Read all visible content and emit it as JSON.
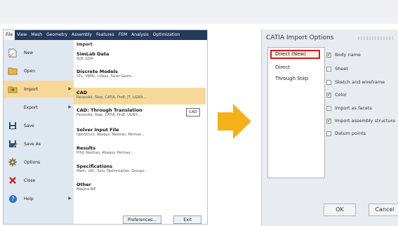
{
  "menubar": [
    "File",
    "View",
    "Mesh",
    "Geometry",
    "Assembly",
    "Features",
    "FEM",
    "Analysis",
    "Optimization"
  ],
  "file_menu": [
    {
      "label": "New",
      "icon": "new-file-icon",
      "arrow": false
    },
    {
      "label": "Open",
      "icon": "open-folder-icon",
      "arrow": false
    },
    {
      "label": "Import",
      "icon": "import-icon",
      "arrow": true
    },
    {
      "label": "Export",
      "icon": "",
      "arrow": true
    },
    {
      "label": "Save",
      "icon": "save-icon",
      "arrow": false
    },
    {
      "label": "Save As",
      "icon": "save-as-icon",
      "arrow": false
    },
    {
      "label": "Options",
      "icon": "gear-icon",
      "arrow": false
    },
    {
      "label": "Close",
      "icon": "close-icon",
      "arrow": false
    },
    {
      "label": "Help",
      "icon": "help-icon",
      "arrow": true
    }
  ],
  "import_panel": {
    "heading": "Import",
    "entries": [
      {
        "title": "SimLab Data",
        "subtitle": "SLB, GDA"
      },
      {
        "title": "Discrete Models",
        "subtitle": "STL, VRML, I-Deas, Facet Geom..."
      },
      {
        "title": "CAD",
        "subtitle": "Parasolid, Step, CATIA, ProE, JT, UGNX..."
      },
      {
        "title": "CAD: Through Translation",
        "subtitle": "Parasolid, Step, CATIA, ProE, UGNX..."
      },
      {
        "title": "Solver Input File",
        "subtitle": "OptiStruct, Abaqus, Nastran, Permas..."
      },
      {
        "title": "Results",
        "subtitle": "H3d, Nastran, Abaqus, Permas..."
      },
      {
        "title": "Specifications",
        "subtitle": "Mesh, LBC, Solu, Optimization, Groups..."
      },
      {
        "title": "Other",
        "subtitle": "Medina BIF"
      }
    ],
    "cad_button": "CAD",
    "preferences_button": "Preferences...",
    "exit_button": "Exit"
  },
  "dialog": {
    "title": "CATIA Import Options",
    "list_items": [
      "Direct (New)",
      "Direct",
      "Through Step"
    ],
    "options": [
      {
        "label": "Body name",
        "checked": true
      },
      {
        "label": "Sheet",
        "checked": false
      },
      {
        "label": "Sketch and wireframe",
        "checked": false
      },
      {
        "label": "Color",
        "checked": true
      },
      {
        "label": "Import as facets",
        "checked": false
      },
      {
        "label": "Import assembly structure",
        "checked": true
      },
      {
        "label": "Datum points",
        "checked": false
      }
    ],
    "ok": "OK",
    "cancel": "Cancel"
  },
  "colors": {
    "menubar": "#253a5c",
    "highlight": "#f6d99a",
    "arrow": "#f3b21a",
    "selection_border": "#d11c1c"
  }
}
